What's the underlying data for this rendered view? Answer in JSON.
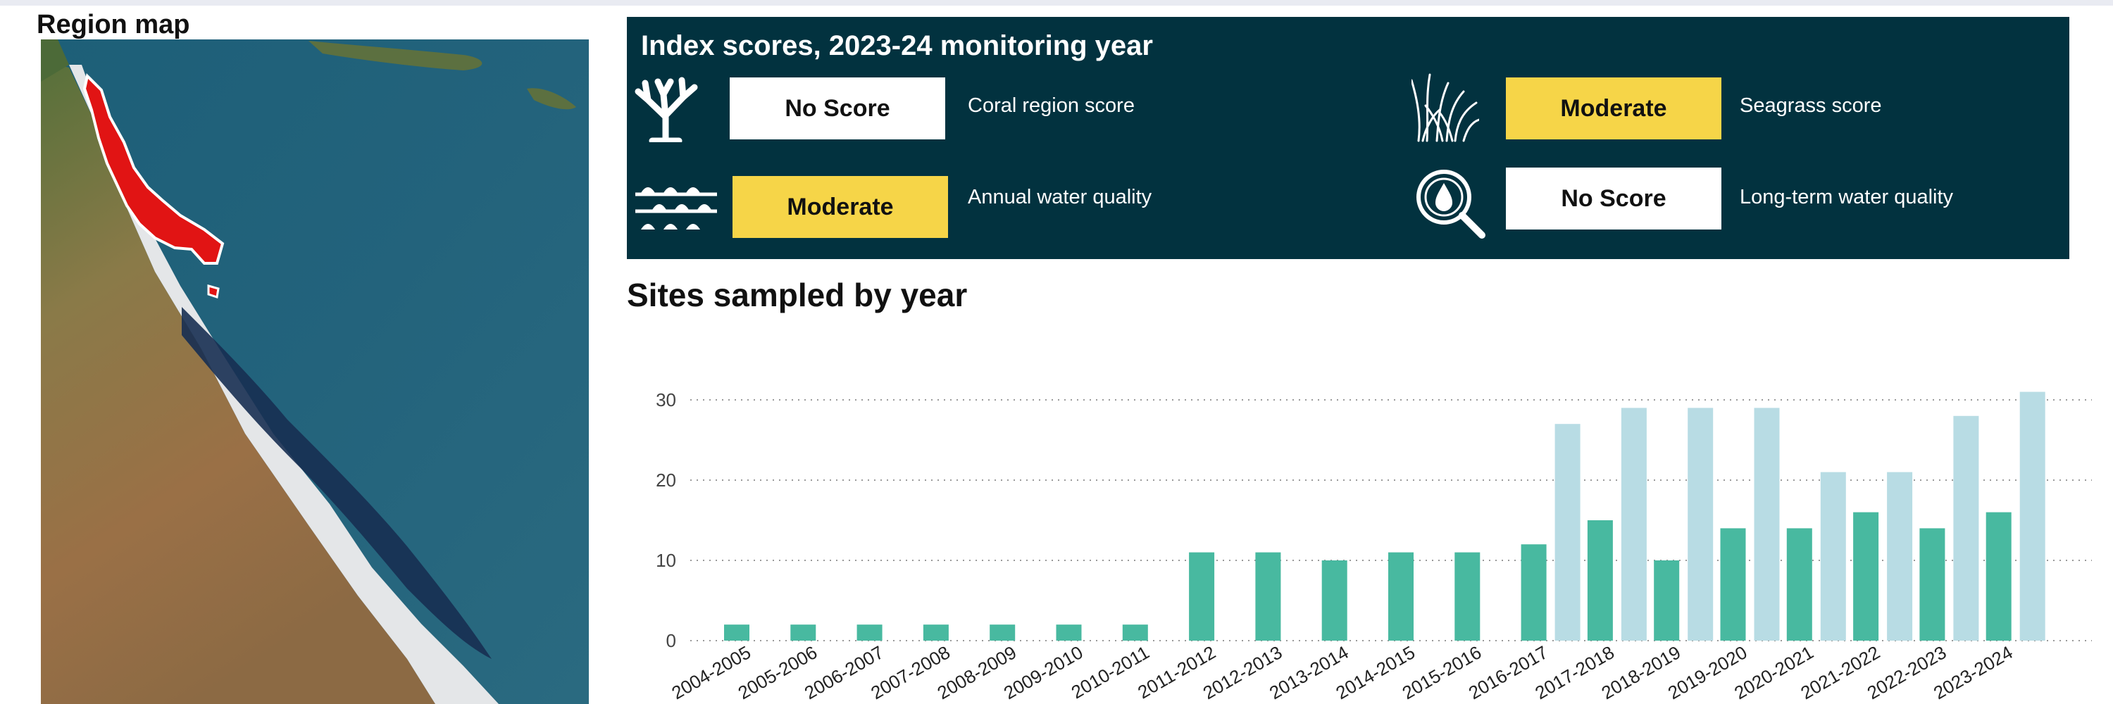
{
  "map": {
    "title": "Region map"
  },
  "index_scores": {
    "title": "Index scores, 2023-24 monitoring year",
    "items": [
      {
        "badge": "No Score",
        "label": "Coral region score",
        "badge_color": "#ffffff",
        "icon": "coral-icon"
      },
      {
        "badge": "Moderate",
        "label": "Seagrass score",
        "badge_color": "#f6d548",
        "icon": "seagrass-icon"
      },
      {
        "badge": "Moderate",
        "label": "Annual water quality",
        "badge_color": "#f6d548",
        "icon": "water-waves-icon"
      },
      {
        "badge": "No Score",
        "label": "Long-term water quality",
        "badge_color": "#ffffff",
        "icon": "water-drop-magnifier-icon"
      }
    ]
  },
  "sites_chart": {
    "title": "Sites sampled by year"
  },
  "chart_data": {
    "type": "bar",
    "title": "Sites sampled by year",
    "categories": [
      "2004-2005",
      "2005-2006",
      "2006-2007",
      "2007-2008",
      "2008-2009",
      "2009-2010",
      "2010-2011",
      "2011-2012",
      "2012-2013",
      "2013-2014",
      "2014-2015",
      "2015-2016",
      "2016-2017",
      "2017-2018",
      "2018-2019",
      "2019-2020",
      "2020-2021",
      "2021-2022",
      "2022-2023",
      "2023-2024"
    ],
    "series": [
      {
        "color": "#48b9a0",
        "values": [
          2,
          2,
          2,
          2,
          2,
          2,
          2,
          11,
          11,
          10,
          11,
          11,
          12,
          15,
          10,
          14,
          14,
          16,
          14,
          16
        ]
      },
      {
        "color": "#b8dce4",
        "values": [
          null,
          null,
          null,
          null,
          null,
          null,
          null,
          null,
          null,
          null,
          null,
          null,
          27,
          29,
          29,
          29,
          21,
          21,
          28,
          31
        ]
      }
    ],
    "yticks": [
      0,
      10,
      20,
      30
    ],
    "ylim": [
      0,
      34
    ],
    "grid": true,
    "legend": "none"
  }
}
